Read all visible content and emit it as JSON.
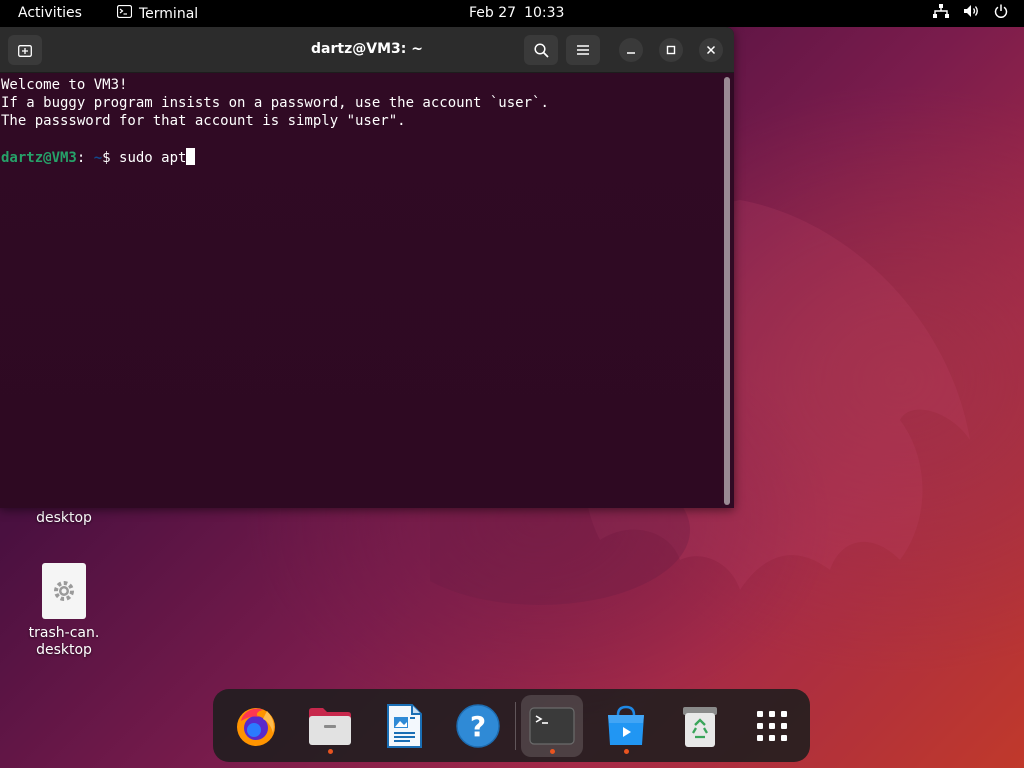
{
  "topbar": {
    "activities": "Activities",
    "app_name": "Terminal",
    "date": "Feb 27",
    "time": "10:33"
  },
  "terminal": {
    "title": "dartz@VM3: ~",
    "lines": [
      "Welcome to VM3!",
      "If a buggy program insists on a password, use the account `user`.",
      "The passsword for that account is simply \"user\"."
    ],
    "prompt_user": "dartz@VM3",
    "prompt_sep": ":",
    "prompt_path": " ~",
    "prompt_symbol": "$ ",
    "command": "sudo apt"
  },
  "desktop": {
    "icons": [
      {
        "label_line1": "desktop",
        "label_line2": ""
      },
      {
        "label_line1": "trash-can.",
        "label_line2": "desktop"
      }
    ]
  },
  "dock": {
    "items": [
      {
        "name": "Firefox",
        "icon": "firefox-icon",
        "running": false
      },
      {
        "name": "Files",
        "icon": "files-icon",
        "running": true
      },
      {
        "name": "LibreOffice Writer",
        "icon": "writer-icon",
        "running": false
      },
      {
        "name": "Help",
        "icon": "help-icon",
        "running": false
      },
      {
        "name": "Terminal",
        "icon": "terminal-icon",
        "running": true,
        "active": true
      },
      {
        "name": "Ubuntu Software",
        "icon": "software-icon",
        "running": true
      },
      {
        "name": "Trash",
        "icon": "trash-icon",
        "running": false
      },
      {
        "name": "Show Applications",
        "icon": "app-grid-icon",
        "running": false
      }
    ]
  },
  "colors": {
    "accent": "#e95420",
    "terminal_bg": "#300a24",
    "prompt_user": "#26a269",
    "prompt_path": "#12488b"
  }
}
